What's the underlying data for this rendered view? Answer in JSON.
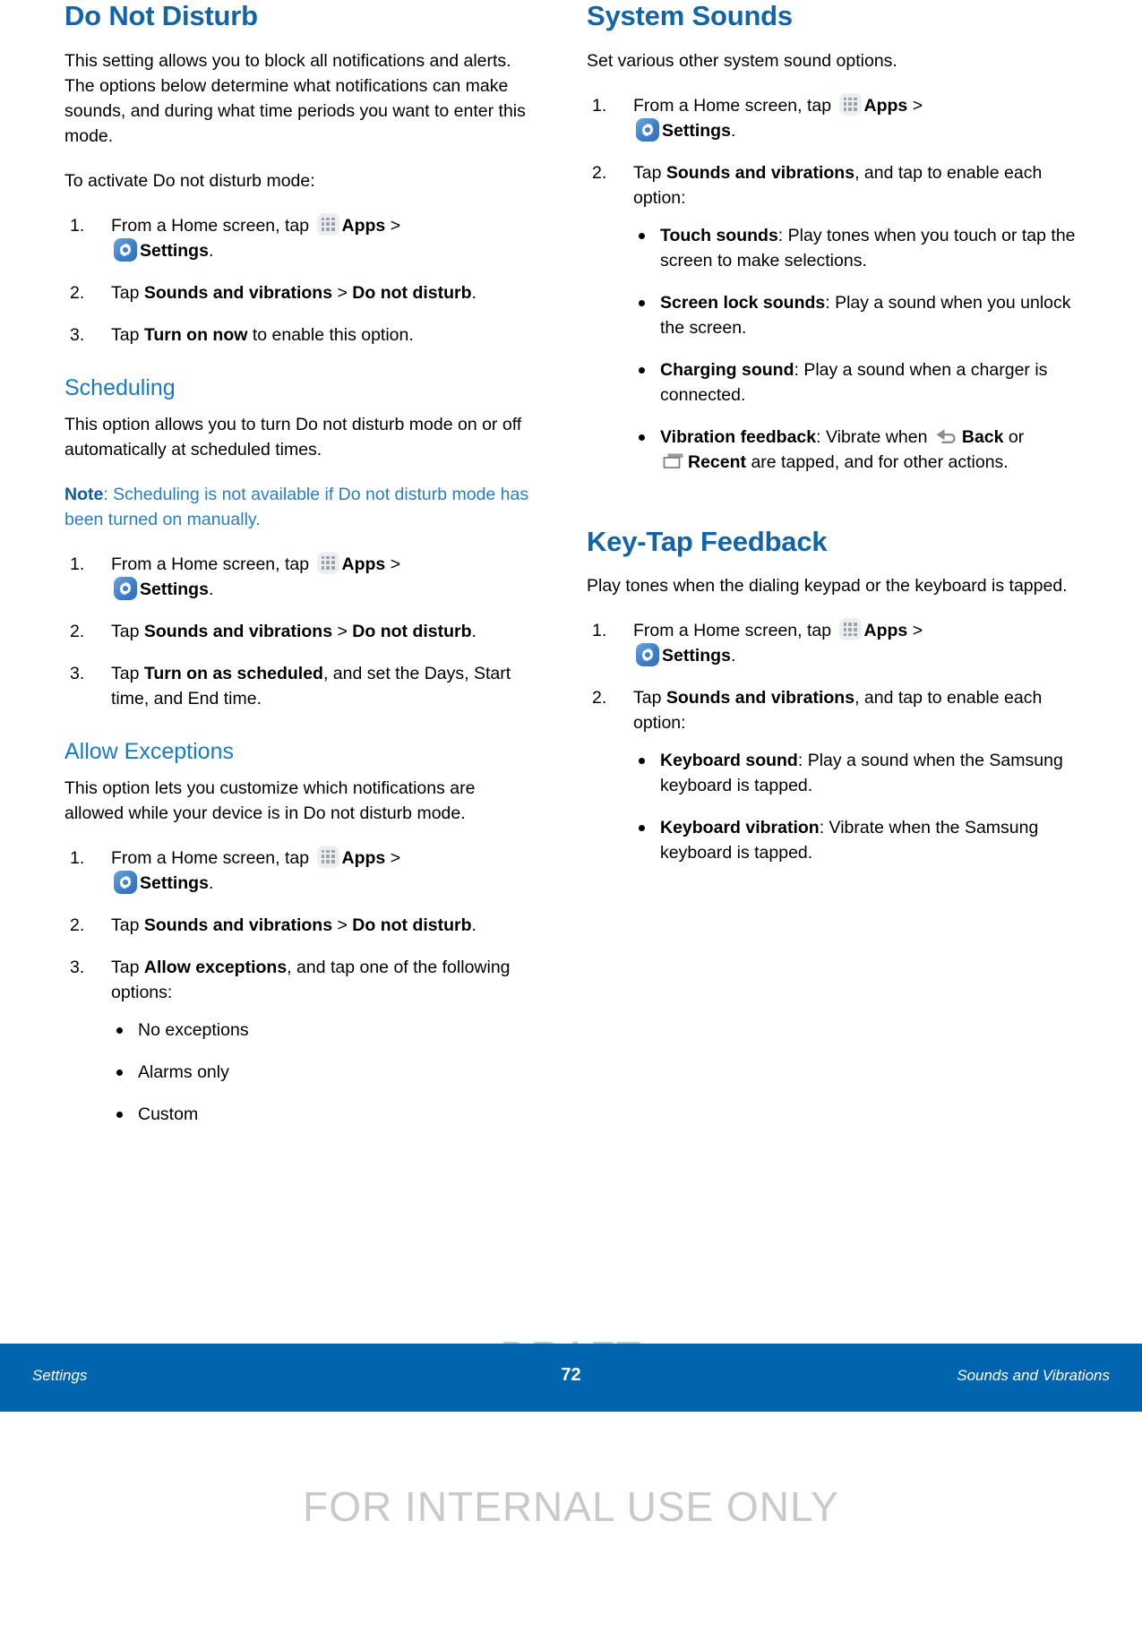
{
  "colors": {
    "heading_blue": "#1263a8",
    "subheading_blue": "#1a7ac4",
    "note_blue": "#2b7cc0",
    "footer_blue": "#0065ae",
    "watermark_gray": "#c9c9c9",
    "settings_icon_blue": "#3f7fc8",
    "apps_icon_gray": "#eceef0"
  },
  "icons": {
    "apps": "apps-grid-icon",
    "settings": "settings-gear-icon",
    "back": "back-arrow-icon",
    "recent": "recent-apps-icon"
  },
  "left_column": {
    "title": "Do Not Disturb",
    "intro": "This setting allows you to block all notifications and alerts. The options below determine what notifications can make sounds, and during what time periods you want to enter this mode.",
    "activate_lead": "To activate Do not disturb mode:",
    "steps_activate": {
      "n1": "1.",
      "s1_a": "From a Home screen, tap",
      "s1_apps": "Apps",
      "s1_gt": ">",
      "s1_settings": "Settings",
      "s1_end": ".",
      "n2": "2.",
      "s2_a": "Tap",
      "s2_b1": "Sounds and vibrations",
      "s2_gt": ">",
      "s2_b2": "Do not disturb",
      "s2_end": ".",
      "n3": "3.",
      "s3_a": "Tap",
      "s3_b": "Turn on now",
      "s3_c": "to enable this option."
    },
    "scheduling": {
      "heading": "Scheduling",
      "body": "This option allows you to turn Do not disturb mode on or off automatically at scheduled times.",
      "note_label": "Note",
      "note_text": ": Scheduling is not available if Do not disturb mode has been turned on manually.",
      "steps": {
        "n1": "1.",
        "s1_a": "From a Home screen, tap",
        "s1_apps": "Apps",
        "s1_gt": ">",
        "s1_settings": "Settings",
        "s1_end": ".",
        "n2": "2.",
        "s2_a": "Tap",
        "s2_b1": "Sounds and vibrations",
        "s2_gt": ">",
        "s2_b2": "Do not disturb",
        "s2_end": ".",
        "n3": "3.",
        "s3_a": "Tap",
        "s3_b": "Turn on as scheduled",
        "s3_c": ", and set the Days, Start time, and End time."
      }
    },
    "allow_exceptions": {
      "heading": "Allow Exceptions",
      "body": "This option lets you customize which notifications are allowed while your device is in Do not disturb mode.",
      "steps": {
        "n1": "1.",
        "s1_a": "From a Home screen, tap",
        "s1_apps": "Apps",
        "s1_gt": ">",
        "s1_settings": "Settings",
        "s1_end": ".",
        "n2": "2.",
        "s2_a": "Tap",
        "s2_b1": "Sounds and vibrations",
        "s2_gt": ">",
        "s2_b2": "Do not disturb",
        "s2_end": ".",
        "n3": "3.",
        "s3_a": "Tap",
        "s3_b": "Allow exceptions",
        "s3_c": ", and tap one of the following options:"
      },
      "options": [
        "No exceptions",
        "Alarms only",
        "Custom"
      ]
    }
  },
  "right_column": {
    "system_sounds": {
      "heading": "System Sounds",
      "body": "Set various other system sound options.",
      "steps": {
        "n1": "1.",
        "s1_a": "From a Home screen, tap",
        "s1_apps": "Apps",
        "s1_gt": ">",
        "s1_settings": "Settings",
        "s1_end": ".",
        "n2": "2.",
        "s2_a": "Tap",
        "s2_b1": "Sounds and vibrations",
        "s2_c": ", and tap to enable each option:"
      },
      "options": [
        {
          "term": "Touch sounds",
          "desc": ": Play tones when you touch or tap the screen to make selections."
        },
        {
          "term": "Screen lock sounds",
          "desc": ": Play a sound when you unlock the screen."
        },
        {
          "term": "Charging sound",
          "desc": ": Play a sound when a charger is connected."
        }
      ],
      "vibration_feedback": {
        "term": "Vibration feedback",
        "part1": ": Vibrate when",
        "back_label": "Back",
        "or_word": "or",
        "recent_label": "Recent",
        "part2": "are tapped, and for other actions."
      }
    },
    "key_tap_feedback": {
      "heading": "Key-Tap Feedback",
      "body": "Play tones when the dialing keypad or the keyboard is tapped.",
      "steps": {
        "n1": "1.",
        "s1_a": "From a Home screen, tap",
        "s1_apps": "Apps",
        "s1_gt": ">",
        "s1_settings": "Settings",
        "s1_end": ".",
        "n2": "2.",
        "s2_a": "Tap",
        "s2_b1": "Sounds and vibrations",
        "s2_c": ", and tap to enable each option:"
      },
      "options": [
        {
          "term": "Keyboard sound",
          "desc": ": Play a sound when the Samsung keyboard is tapped."
        },
        {
          "term": "Keyboard vibration",
          "desc": ": Vibrate when the Samsung keyboard is tapped."
        }
      ]
    }
  },
  "watermark": {
    "line1": "DRAFT",
    "line2": "FOR INTERNAL USE ONLY"
  },
  "footer": {
    "left": "Settings",
    "page_number": "72",
    "right": "Sounds and Vibrations"
  }
}
